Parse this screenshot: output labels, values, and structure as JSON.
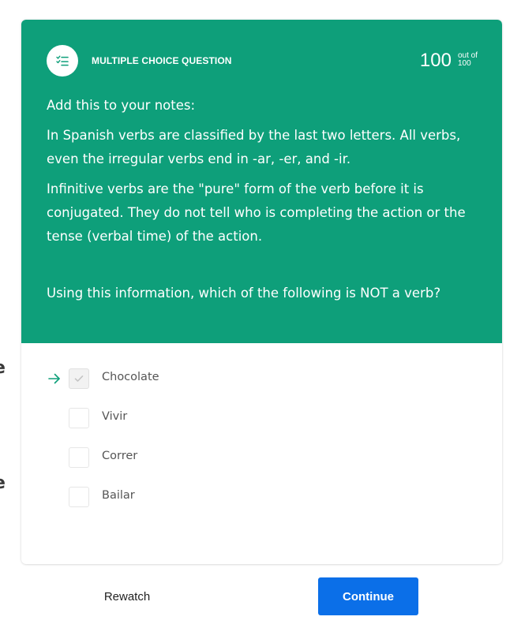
{
  "side_fragments": [
    "e",
    "e"
  ],
  "header": {
    "icon": "checklist-icon",
    "question_type": "MULTIPLE CHOICE QUESTION",
    "score": "100",
    "score_out_of_label": "out of",
    "score_max": "100"
  },
  "content": {
    "notes_intro": "Add this to your notes:",
    "paragraph_1": "In Spanish verbs are classified by the last two letters. All verbs, even the irregular verbs end in -ar, -er, and -ir.",
    "paragraph_2": "Infinitive verbs  are the \"pure\" form of the verb before it is conjugated. They do not tell who is completing the action or the tense (verbal time) of the action.",
    "question": "Using this information, which of the following is NOT a verb?"
  },
  "options": [
    {
      "label": "Chocolate",
      "selected": true
    },
    {
      "label": "Vivir",
      "selected": false
    },
    {
      "label": "Correr",
      "selected": false
    },
    {
      "label": "Bailar",
      "selected": false
    }
  ],
  "footer": {
    "rewatch_label": "Rewatch",
    "continue_label": "Continue"
  },
  "colors": {
    "header_bg": "#0e9f7a",
    "accent_arrow": "#0e9f7a",
    "continue_bg": "#0b6fe8"
  }
}
